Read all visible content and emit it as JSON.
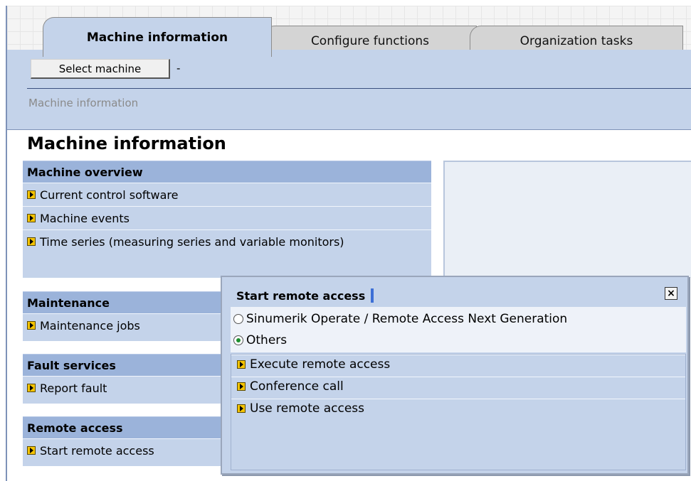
{
  "tabs": [
    {
      "label": "Machine information",
      "active": true
    },
    {
      "label": "Configure functions",
      "active": false
    },
    {
      "label": "Organization tasks",
      "active": false
    }
  ],
  "header": {
    "select_machine_label": "Select machine",
    "machine_value": "-",
    "breadcrumb": "Machine information"
  },
  "page_title": "Machine information",
  "sections": {
    "overview": {
      "title": "Machine overview",
      "items": [
        "Current control software",
        "Machine events",
        "Time series (measuring series and variable monitors)"
      ]
    },
    "maintenance": {
      "title": "Maintenance",
      "items": [
        "Maintenance jobs"
      ]
    },
    "fault": {
      "title": "Fault services",
      "items": [
        "Report fault"
      ]
    },
    "remote": {
      "title": "Remote access",
      "items": [
        "Start remote access"
      ]
    }
  },
  "popup": {
    "title": "Start remote access",
    "close_label": "×",
    "options": [
      {
        "label": "Sinumerik Operate / Remote Access Next Generation",
        "selected": false
      },
      {
        "label": "Others",
        "selected": true
      }
    ],
    "items": [
      "Execute remote access",
      "Conference call",
      "Use remote access"
    ]
  },
  "colors": {
    "panel": "#c4d3ea",
    "section_header": "#9bb3da",
    "arrow_icon": "#f5c400",
    "radio_selected": "#1c8f2e"
  }
}
